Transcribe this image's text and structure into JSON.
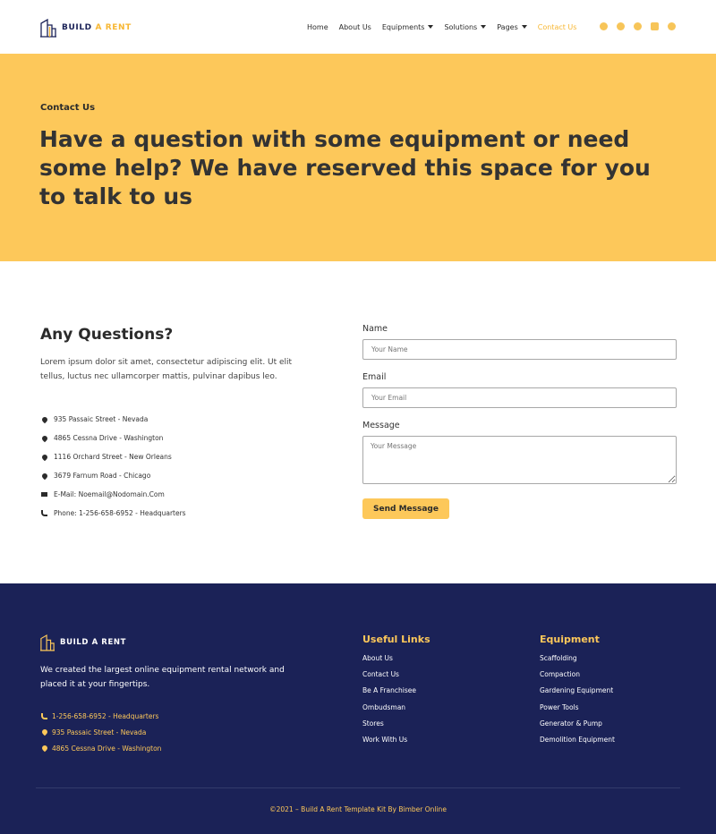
{
  "header": {
    "logo_main": "BUILD",
    "logo_accent": "A RENT",
    "nav": [
      {
        "label": "Home",
        "dropdown": false,
        "active": false
      },
      {
        "label": "About Us",
        "dropdown": false,
        "active": false
      },
      {
        "label": "Equipments",
        "dropdown": true,
        "active": false
      },
      {
        "label": "Solutions",
        "dropdown": true,
        "active": false
      },
      {
        "label": "Pages",
        "dropdown": true,
        "active": false
      },
      {
        "label": "Contact Us",
        "dropdown": false,
        "active": true
      }
    ],
    "social_icons": [
      "instagram-icon",
      "facebook-icon",
      "twitter-icon",
      "youtube-icon",
      "pinterest-icon"
    ]
  },
  "hero": {
    "label": "Contact Us",
    "title": "Have a question with some equipment or need some help? We have reserved this space for you to talk to us"
  },
  "contact": {
    "title": "Any Questions?",
    "text": "Lorem ipsum dolor sit amet, consectetur adipiscing elit. Ut elit tellus, luctus nec ullamcorper mattis, pulvinar dapibus leo.",
    "info": [
      {
        "icon": "map-pin-icon",
        "text": "935 Passaic Street - Nevada"
      },
      {
        "icon": "map-pin-icon",
        "text": "4865 Cessna Drive - Washington"
      },
      {
        "icon": "map-pin-icon",
        "text": "1116 Orchard Street - New Orleans"
      },
      {
        "icon": "map-pin-icon",
        "text": "3679 Farnum Road - Chicago"
      },
      {
        "icon": "envelope-icon",
        "text": "E-Mail: Noemail@Nodomain.Com"
      },
      {
        "icon": "phone-icon",
        "text": "Phone: 1-256-658-6952 - Headquarters"
      }
    ]
  },
  "form": {
    "name_label": "Name",
    "name_placeholder": "Your Name",
    "email_label": "Email",
    "email_placeholder": "Your Email",
    "message_label": "Message",
    "message_placeholder": "Your Message",
    "send_label": "Send Message"
  },
  "footer": {
    "logo": "BUILD A RENT",
    "description": "We created the largest online equipment rental network and placed it at your fingertips.",
    "contacts": [
      {
        "icon": "phone-icon",
        "text": "1-256-658-6952 - Headquarters"
      },
      {
        "icon": "map-pin-icon",
        "text": "935 Passaic Street - Nevada"
      },
      {
        "icon": "map-pin-icon",
        "text": "4865 Cessna Drive - Washington"
      }
    ],
    "useful_links_title": "Useful Links",
    "useful_links": [
      "About Us",
      "Contact Us",
      "Be A Franchisee",
      "Ombudsman",
      "Stores",
      "Work With Us"
    ],
    "equipment_title": "Equipment",
    "equipment_links": [
      "Scaffolding",
      "Compaction",
      "Gardening Equipment",
      "Power Tools",
      "Generator & Pump",
      "Demolition Equipment"
    ],
    "copyright": "©2021 – Build A Rent Template Kit By Bimber Online"
  },
  "colors": {
    "accent": "#fdc85a",
    "navy": "#1b2257",
    "text": "#2b2b2b"
  }
}
